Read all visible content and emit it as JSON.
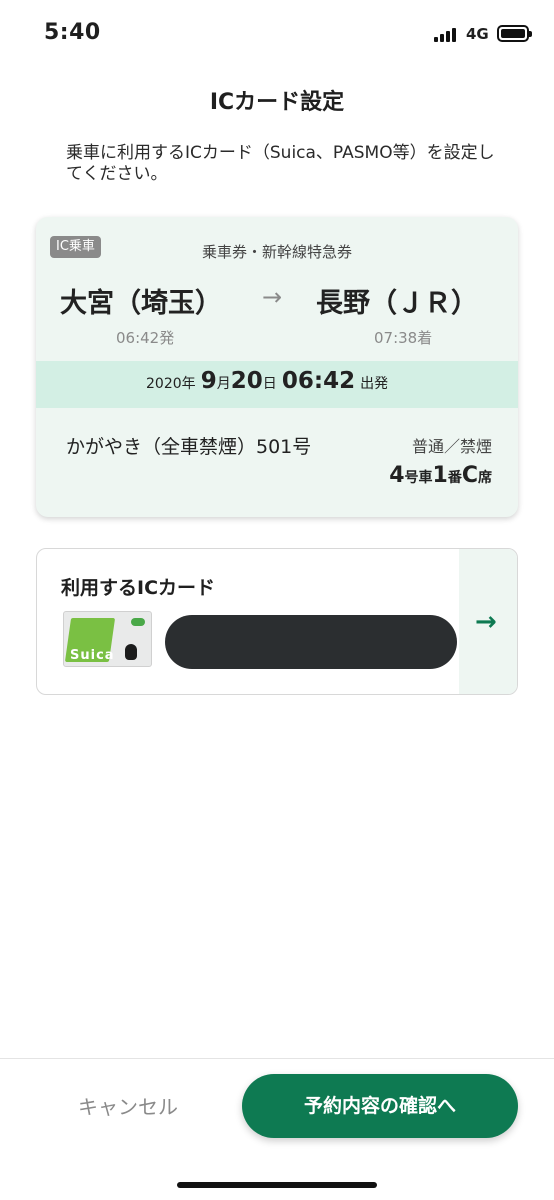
{
  "status_bar": {
    "time": "5:40",
    "network": "4G",
    "signal_icon": "cellular-signal-icon",
    "battery_icon": "battery-icon"
  },
  "page": {
    "title": "ICカード設定",
    "description": "乗車に利用するICカード（Suica、PASMO等）を設定してください。"
  },
  "ticket": {
    "badge": "IC乗車",
    "type": "乗車券・新幹線特急券",
    "from_station": "大宮（埼玉）",
    "arrow": "→",
    "to_station": "長野（ＪＲ）",
    "departure_time": "06:42発",
    "arrival_time": "07:38着",
    "date": {
      "year": "2020年",
      "month": "9",
      "month_unit": "月",
      "day": "20",
      "day_unit": "日",
      "time": "06:42",
      "suffix": "出発"
    },
    "train_name": "かがやき（全車禁煙）501号",
    "seat_class": "普通／禁煙",
    "seat": {
      "car": "4",
      "car_unit": "号車",
      "row": "1",
      "row_unit": "番",
      "seat_letter": "C",
      "seat_unit": "席"
    }
  },
  "ic_card": {
    "title": "利用するICカード",
    "card_name": "Suica",
    "arrow": "→"
  },
  "actions": {
    "cancel": "キャンセル",
    "confirm": "予約内容の確認へ"
  },
  "colors": {
    "accent": "#0e7a52",
    "card_bg": "#eef6f2",
    "date_band": "#d3efe4"
  }
}
